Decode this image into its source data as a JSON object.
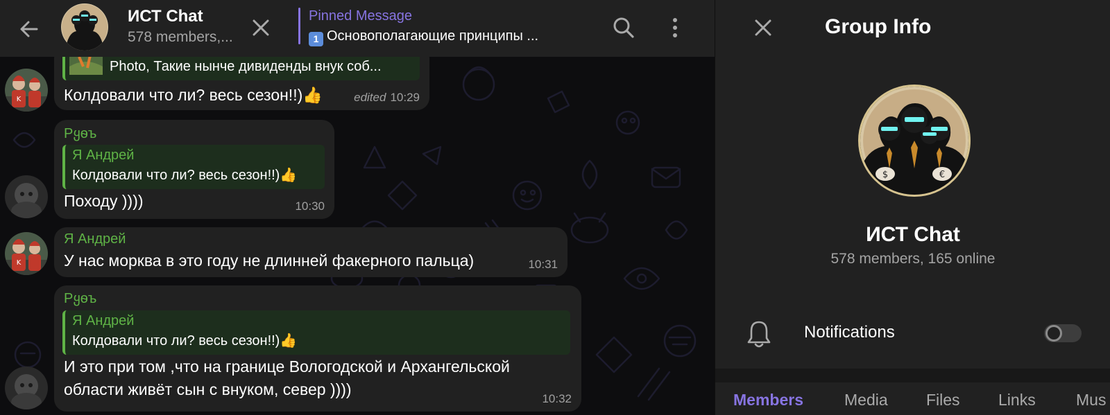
{
  "header": {
    "title": "ИСТ Chat",
    "status": "578 members,...",
    "pinned_label": "Pinned Message",
    "pinned_keycap": "1",
    "pinned_text": "Основополагающие принципы ..."
  },
  "messages": [
    {
      "reply_text": "Photo, Такие нынче дивиденды внук соб...",
      "text": "Колдовали что ли? весь сезон!!)👍",
      "edited": "edited",
      "time": "10:29"
    },
    {
      "sender": "Pყѳъ",
      "reply_name": "Я Андрей",
      "reply_text": "Колдовали что ли? весь сезон!!)👍",
      "text": "Походу ))))",
      "time": "10:30"
    },
    {
      "sender": "Я Андрей",
      "text": "У нас морква в это году не длинней факерного пальца)",
      "time": "10:31"
    },
    {
      "sender": "Pყѳъ",
      "reply_name": "Я Андрей",
      "reply_text": "Колдовали что ли? весь сезон!!)👍",
      "text_line1": "И это при том ,что на границе Вологодской и Архангельской",
      "text_line2": "области живёт сын с внуком,  север ))))",
      "time": "10:32"
    }
  ],
  "info": {
    "title": "Group Info",
    "name": "ИСТ Chat",
    "status": "578 members, 165 online",
    "notifications_label": "Notifications",
    "notifications_on": false,
    "tabs": [
      "Members",
      "Media",
      "Files",
      "Links",
      "Mus"
    ]
  },
  "colors": {
    "accent": "#8774e1",
    "sender_green": "#5fb346",
    "bubble": "#212121",
    "panel": "#212121"
  },
  "icons": [
    "back-arrow-icon",
    "close-icon",
    "search-icon",
    "more-vertical-icon",
    "bell-icon"
  ]
}
